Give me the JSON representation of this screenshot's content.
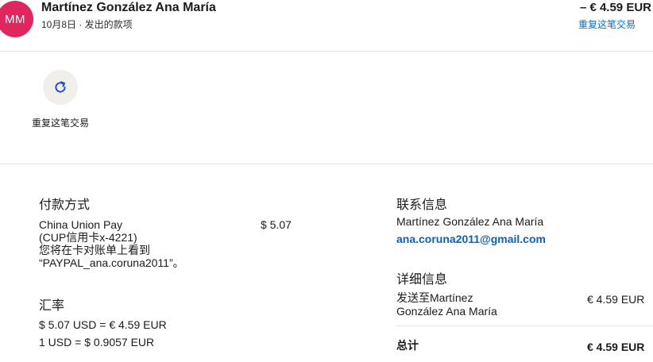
{
  "transaction": {
    "avatar_initials": "MM",
    "name": "Martínez González Ana María",
    "subtitle": "10月8日 · 发出的款项",
    "amount": "– € 4.59 EUR",
    "repeat_link": "重复这笔交易"
  },
  "actions": {
    "repeat_label": "重复这笔交易",
    "repeat_icon": "refresh-icon"
  },
  "payment": {
    "title": "付款方式",
    "method_lines": [
      "China Union Pay",
      "(CUP信用卡x-4221)",
      "您将在卡对账单上看到",
      "“PAYPAL_ana.coruna2011”。"
    ],
    "amount": "$ 5.07"
  },
  "exchange": {
    "title": "汇率",
    "line1": "$ 5.07 USD = € 4.59 EUR",
    "line2": "1 USD = $ 0.9057 EUR"
  },
  "contact": {
    "title": "联系信息",
    "name": "Martínez González Ana María",
    "email": "ana.coruna2011@gmail.com"
  },
  "details": {
    "title": "详细信息",
    "sent_to_lines": [
      "发送至Martínez",
      "González Ana María"
    ],
    "sent_amount": "€ 4.59 EUR",
    "total_label": "总计",
    "total_amount": "€ 4.59 EUR"
  },
  "colors": {
    "avatar": "#e0265f",
    "link": "#0070e0",
    "email": "#0a5ec4"
  }
}
